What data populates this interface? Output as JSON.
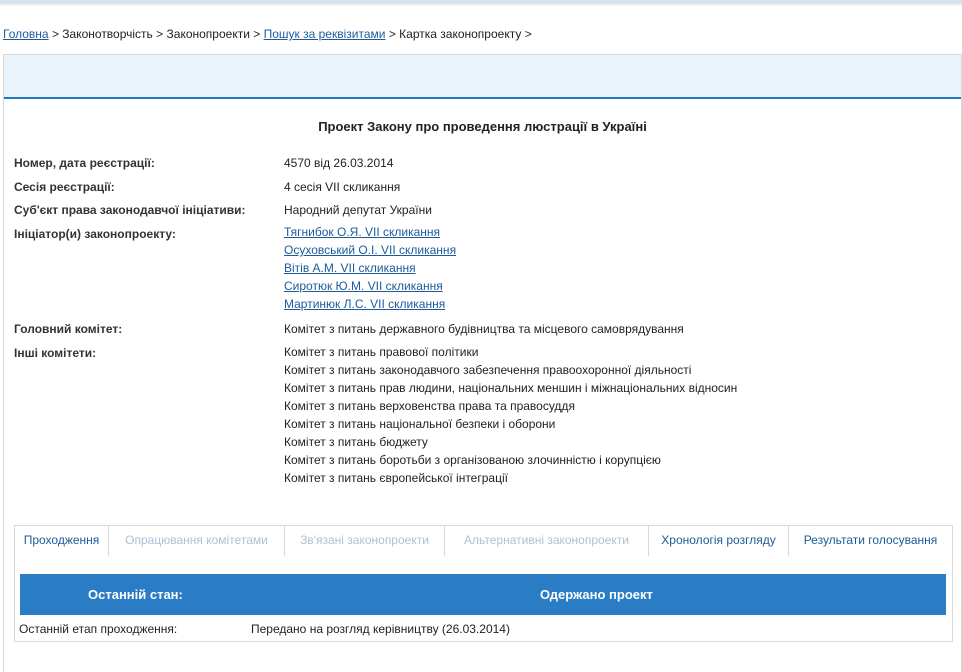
{
  "breadcrumb": {
    "home": "Головна",
    "lawmaking": "Законотворчість",
    "bills": "Законопроекти",
    "search": "Пошук за реквізитами",
    "card": "Картка законопроекту",
    "separator": ">"
  },
  "title": "Проект Закону про проведення люстрації в Україні",
  "fields": {
    "number_date": {
      "label": "Номер, дата реєстрації:",
      "value": "4570 від 26.03.2014"
    },
    "session": {
      "label": "Сесія реєстрації:",
      "value": "4 сесія VII скликання"
    },
    "subject": {
      "label": "Суб'єкт права законодавчої ініціативи:",
      "value": "Народний депутат України"
    },
    "initiators": {
      "label": "Ініціатор(и) законопроекту:",
      "items": [
        "Тягнибок О.Я. VII скликання",
        "Осуховський О.І. VII скликання",
        "Вітів А.М. VII скликання",
        "Сиротюк Ю.М. VII скликання",
        "Мартинюк Л.С. VII скликання"
      ]
    },
    "main_committee": {
      "label": "Головний комітет:",
      "value": "Комітет з питань державного будівництва та місцевого самоврядування"
    },
    "other_committees": {
      "label": "Інші комітети:",
      "items": [
        "Комітет з питань правової політики",
        "Комітет з питань законодавчого забезпечення правоохоронної діяльності",
        "Комітет з питань прав людини, національних меншин і міжнаціональних відносин",
        "Комітет з питань верховенства права та правосуддя",
        "Комітет з питань національної безпеки і оборони",
        "Комітет з питань бюджету",
        "Комітет з питань боротьби з організованою злочинністю і корупцією",
        "Комітет з питань європейської інтеграції"
      ]
    }
  },
  "tabs": [
    {
      "label": "Проходження",
      "state": "active"
    },
    {
      "label": "Опрацювання комітетами",
      "state": "disabled"
    },
    {
      "label": "Зв'язані законопроекти",
      "state": "disabled"
    },
    {
      "label": "Альтернативні законопроекти",
      "state": "disabled"
    },
    {
      "label": "Хронологія розгляду",
      "state": "normal"
    },
    {
      "label": "Результати голосування",
      "state": "normal"
    }
  ],
  "status": {
    "label": "Останній стан:",
    "value": "Одержано проект",
    "stage_label": "Останній етап проходження:",
    "stage_value": "Передано на розгляд керівництву (26.03.2014)"
  },
  "colors": {
    "link": "#1c5b9a",
    "status_bar": "#2a7dc4",
    "header_band": "#e8f3fc"
  }
}
